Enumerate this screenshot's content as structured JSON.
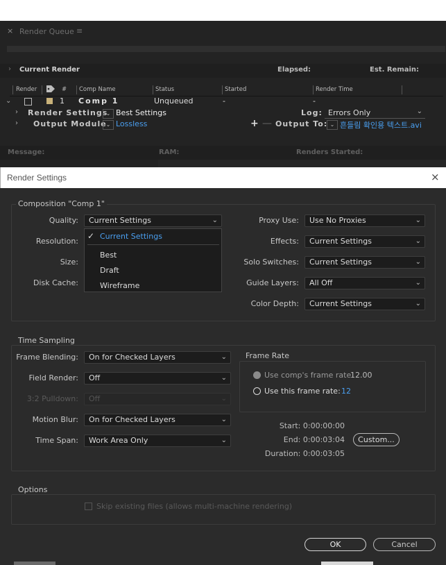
{
  "render_queue": {
    "close_glyph": "×",
    "title": "Render Queue",
    "menu_glyph": "≡",
    "current_render_label": "Current Render",
    "elapsed_label": "Elapsed:",
    "est_remain_label": "Est. Remain:",
    "columns": [
      "Render",
      "#",
      "Comp Name",
      "Status",
      "Started",
      "Render Time"
    ],
    "item": {
      "number": "1",
      "comp_name": "Comp 1",
      "status": "Unqueued",
      "started": "-",
      "render_time": "-"
    },
    "render_settings_label": "Render Settings",
    "render_settings_value": "Best Settings",
    "log_label": "Log:",
    "log_value": "Errors Only",
    "output_module_label": "Output Module",
    "output_module_value": "Lossless",
    "output_to_label": "Output To:",
    "output_to_value": "흔들림 확인용 텍스트.avi",
    "message_label": "Message:",
    "ram_label": "RAM:",
    "renders_started_label": "Renders Started:"
  },
  "dialog": {
    "title": "Render Settings",
    "close_glyph": "×",
    "composition_group": "Composition \"Comp 1\"",
    "quality_label": "Quality:",
    "quality_value": "Current Settings",
    "quality_options": [
      "Current Settings",
      "Best",
      "Draft",
      "Wireframe"
    ],
    "resolution_label": "Resolution:",
    "size_label": "Size:",
    "disk_cache_label": "Disk Cache:",
    "proxy_use_label": "Proxy Use:",
    "proxy_use_value": "Use No Proxies",
    "effects_label": "Effects:",
    "effects_value": "Current Settings",
    "solo_switches_label": "Solo Switches:",
    "solo_switches_value": "Current Settings",
    "guide_layers_label": "Guide Layers:",
    "guide_layers_value": "All Off",
    "color_depth_label": "Color Depth:",
    "color_depth_value": "Current Settings",
    "time_sampling_group": "Time Sampling",
    "frame_blending_label": "Frame Blending:",
    "frame_blending_value": "On for Checked Layers",
    "field_render_label": "Field Render:",
    "field_render_value": "Off",
    "pulldown_label": "3:2 Pulldown:",
    "pulldown_value": "Off",
    "motion_blur_label": "Motion Blur:",
    "motion_blur_value": "On for Checked Layers",
    "time_span_label": "Time Span:",
    "time_span_value": "Work Area Only",
    "frame_rate_group": "Frame Rate",
    "use_comp_rate_label": "Use comp's frame rate",
    "use_comp_rate_value": "12.00",
    "use_this_rate_label": "Use this frame rate:",
    "use_this_rate_value": "12",
    "start_label": "Start: 0:00:00:00",
    "end_label": "End: 0:00:03:04",
    "duration_label": "Duration: 0:00:03:05",
    "custom_button": "Custom...",
    "options_group": "Options",
    "skip_existing_label": "Skip existing files (allows multi-machine rendering)",
    "ok_button": "OK",
    "cancel_button": "Cancel"
  },
  "colors": {
    "accent_blue": "#4a9ff0",
    "panel_bg": "#232323",
    "dialog_bg": "#2b2b2b",
    "label_swatch": "#c9b27a"
  },
  "icons": [
    "close-icon",
    "menu-icon",
    "chevron-down-icon",
    "chevron-right-icon",
    "checkmark-icon",
    "tag-icon"
  ]
}
